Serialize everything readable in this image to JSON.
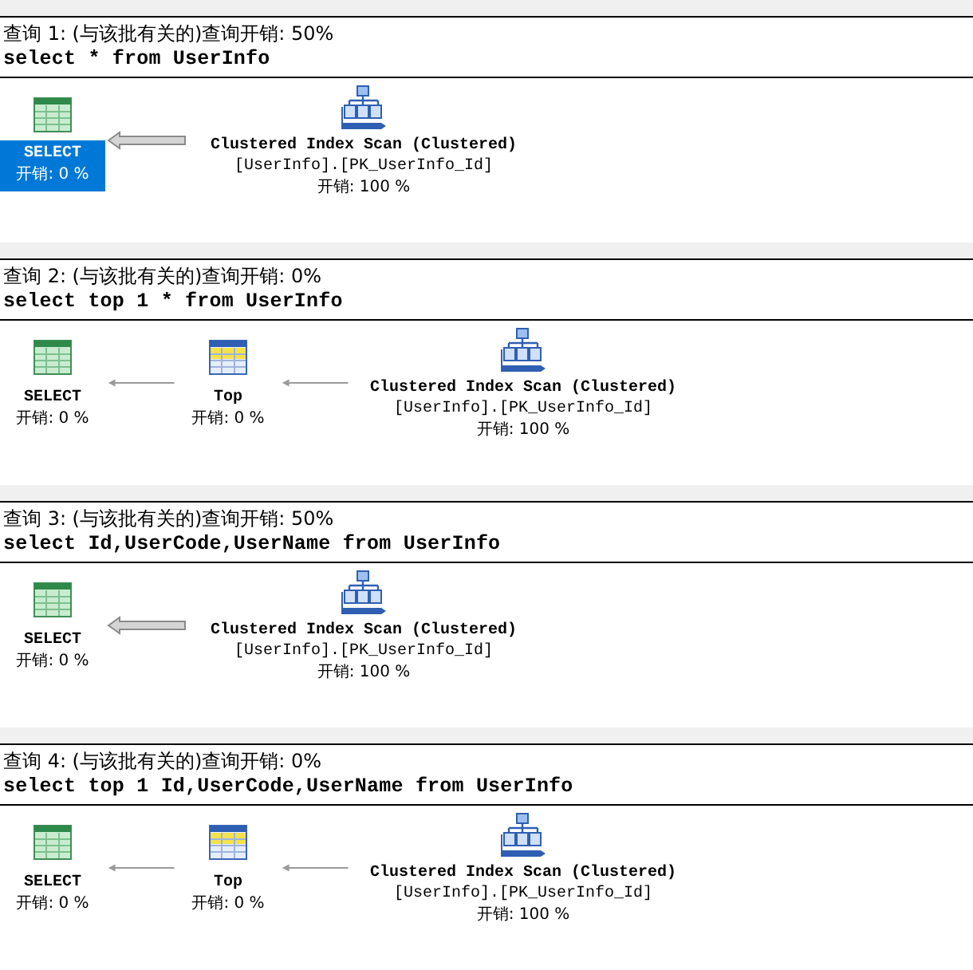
{
  "queries": [
    {
      "header": "查询 1: (与该批有关的)查询开销: 50%",
      "sql": "select * from UserInfo",
      "wide_arrows": true,
      "nodes": [
        {
          "kind": "select",
          "label": "SELECT",
          "cost": "开销: 0 %",
          "selected": true
        },
        {
          "kind": "scan",
          "label": "Clustered Index Scan (Clustered)",
          "object": "[UserInfo].[PK_UserInfo_Id]",
          "cost": "开销: 100 %",
          "selected": false
        }
      ]
    },
    {
      "header": "查询 2: (与该批有关的)查询开销: 0%",
      "sql": "select top 1 * from UserInfo",
      "wide_arrows": false,
      "nodes": [
        {
          "kind": "select",
          "label": "SELECT",
          "cost": "开销: 0 %",
          "selected": false
        },
        {
          "kind": "top",
          "label": "Top",
          "cost": "开销: 0 %",
          "selected": false
        },
        {
          "kind": "scan",
          "label": "Clustered Index Scan (Clustered)",
          "object": "[UserInfo].[PK_UserInfo_Id]",
          "cost": "开销: 100 %",
          "selected": false
        }
      ]
    },
    {
      "header": "查询 3: (与该批有关的)查询开销: 50%",
      "sql": "select Id,UserCode,UserName from UserInfo",
      "wide_arrows": true,
      "nodes": [
        {
          "kind": "select",
          "label": "SELECT",
          "cost": "开销: 0 %",
          "selected": false
        },
        {
          "kind": "scan",
          "label": "Clustered Index Scan (Clustered)",
          "object": "[UserInfo].[PK_UserInfo_Id]",
          "cost": "开销: 100 %",
          "selected": false
        }
      ]
    },
    {
      "header": "查询 4: (与该批有关的)查询开销: 0%",
      "sql": "select top 1 Id,UserCode,UserName from UserInfo",
      "wide_arrows": false,
      "nodes": [
        {
          "kind": "select",
          "label": "SELECT",
          "cost": "开销: 0 %",
          "selected": false
        },
        {
          "kind": "top",
          "label": "Top",
          "cost": "开销: 0 %",
          "selected": false
        },
        {
          "kind": "scan",
          "label": "Clustered Index Scan (Clustered)",
          "object": "[UserInfo].[PK_UserInfo_Id]",
          "cost": "开销: 100 %",
          "selected": false
        }
      ]
    }
  ]
}
